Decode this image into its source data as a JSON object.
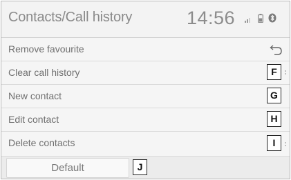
{
  "header": {
    "title": "Contacts/Call history",
    "clock": "14:56",
    "status_icons": [
      "signal-icon",
      "battery-icon",
      "bluetooth-icon"
    ]
  },
  "menu": {
    "items": [
      {
        "label": "Remove favourite",
        "callout": ""
      },
      {
        "label": "Clear call history",
        "callout": "F"
      },
      {
        "label": "New contact",
        "callout": "G"
      },
      {
        "label": "Edit contact",
        "callout": "H"
      },
      {
        "label": "Delete contacts",
        "callout": "I"
      }
    ]
  },
  "footer": {
    "default_label": "Default",
    "default_callout": "J"
  },
  "colors": {
    "text_grey": "#6f6f6f",
    "header_text": "#8a8a8a",
    "callout_border": "#222222"
  }
}
